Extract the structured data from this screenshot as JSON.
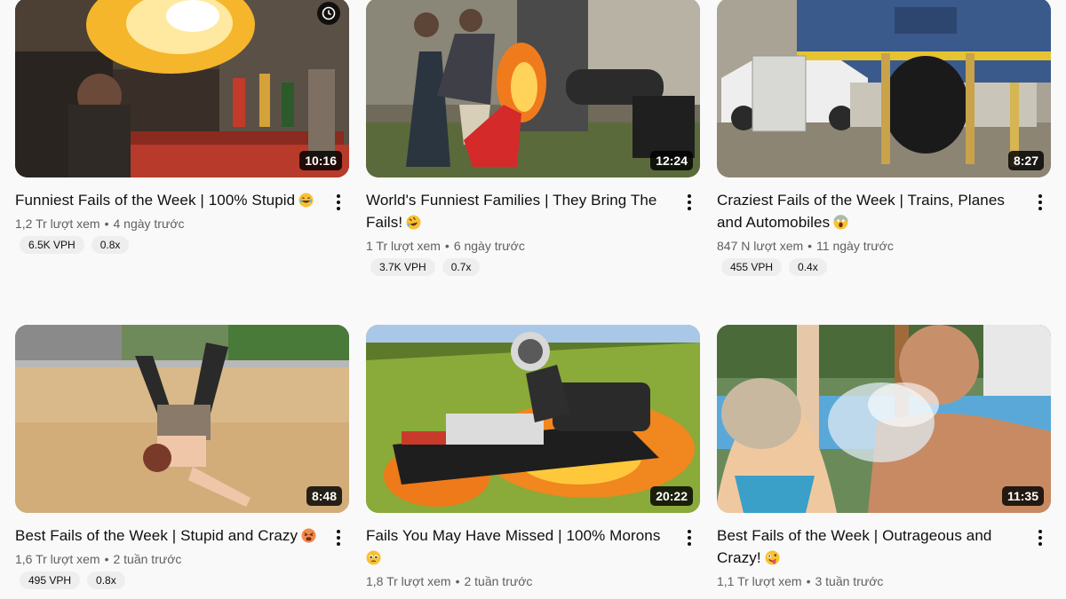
{
  "videos": [
    {
      "title": "Funniest Fails of the Week | 100% Stupid",
      "emoji": "laugh-emoji",
      "views": "1,2 Tr lượt xem",
      "age": "4 ngày trước",
      "duration": "10:16",
      "vph": "6.5K VPH",
      "ratio": "0.8x",
      "thumbnail_icon": "fireball-thumbnail"
    },
    {
      "title": "World's Funniest Families | They Bring The Fails!",
      "emoji": "rofl-emoji",
      "views": "1 Tr lượt xem",
      "age": "6 ngày trước",
      "duration": "12:24",
      "vph": "3.7K VPH",
      "ratio": "0.7x",
      "thumbnail_icon": "grill-fire-thumbnail"
    },
    {
      "title": "Craziest Fails of the Week | Trains, Planes and Automobiles",
      "emoji": "scream-emoji",
      "views": "847 N lượt xem",
      "age": "11 ngày trước",
      "duration": "8:27",
      "vph": "455 VPH",
      "ratio": "0.4x",
      "thumbnail_icon": "train-crash-thumbnail"
    },
    {
      "title": "Best Fails of the Week | Stupid and Crazy",
      "emoji": "tired-emoji",
      "views": "1,6 Tr lượt xem",
      "age": "2 tuần trước",
      "duration": "8:48",
      "vph": "495 VPH",
      "ratio": "0.8x",
      "thumbnail_icon": "ramp-fall-thumbnail"
    },
    {
      "title": "Fails You May Have Missed | 100% Morons",
      "emoji": "pleading-emoji",
      "views": "1,8 Tr lượt xem",
      "age": "2 tuần trước",
      "duration": "20:22",
      "vph": "",
      "ratio": "",
      "thumbnail_icon": "atv-fire-thumbnail"
    },
    {
      "title": "Best Fails of the Week | Outrageous and Crazy!",
      "emoji": "zany-emoji",
      "views": "1,1 Tr lượt xem",
      "age": "3 tuần trước",
      "duration": "11:35",
      "vph": "",
      "ratio": "",
      "thumbnail_icon": "pool-splash-thumbnail"
    }
  ],
  "colors": {
    "background": "#f9f9f9",
    "text_primary": "#0f0f0f",
    "text_secondary": "#606060",
    "chip_bg": "#eeeeee"
  }
}
